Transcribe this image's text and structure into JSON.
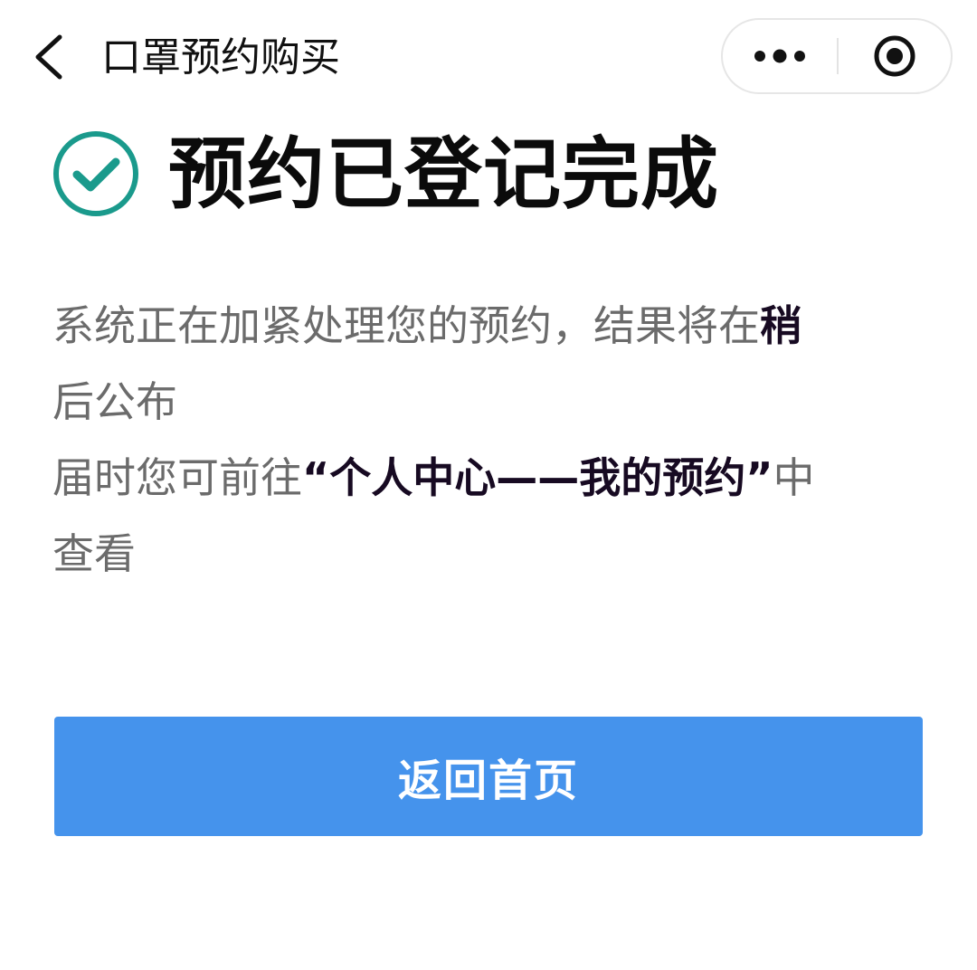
{
  "nav": {
    "title": "口罩预约购买",
    "back_icon": "chevron-left-icon",
    "more_icon": "more-dots-icon",
    "close_icon": "target-close-icon"
  },
  "success": {
    "icon": "check-circle-icon",
    "icon_color": "#1a9a8c",
    "title": "预约已登记完成"
  },
  "message": {
    "line1_text": "系统正在加紧处理您的预约，结果将在",
    "line1_bold": "稍",
    "line2_bold": "后",
    "line2_text": "公布",
    "line3_text": "届时您可前往",
    "line3_bold": "“个人中心——我的预约”",
    "line3_tail": "中",
    "line4_text": "查看"
  },
  "button": {
    "label": "返回首页",
    "color": "#4593ec"
  }
}
